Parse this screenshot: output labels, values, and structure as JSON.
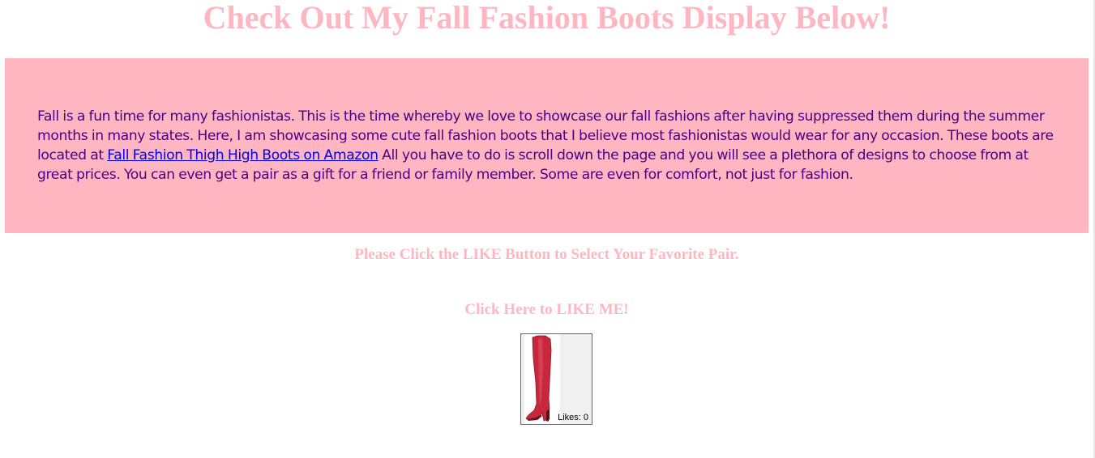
{
  "page": {
    "title": "Check Out My Fall Fashion Boots Display Below!"
  },
  "intro": {
    "text_before_link": "Fall is a fun time for many fashionistas. This is the time whereby we love to showcase our fall fashions after having suppressed them during the summer months in many states. Here, I am showcasing some cute fall fashion boots that I believe most fashionistas would wear for any occasion. These boots are located at ",
    "link_text": "Fall Fashion Thigh High Boots on Amazon",
    "text_after_link": " All you have to do is scroll down the page and you will see a plethora of designs to choose from at great prices. You can even get a pair as a gift for a friend or family member. Some are even for comfort, not just for fashion."
  },
  "instructions": {
    "text": "Please Click the LIKE Button to Select Your Favorite Pair."
  },
  "like_section": {
    "cta_text": "Click Here to LIKE ME!",
    "likes_label": "Likes: 0",
    "image_icon": "red-thigh-high-boot-image"
  },
  "colors": {
    "heading_pink": "#ffb6c1",
    "panel_pink": "#ffb6c1",
    "body_text": "#4b0082",
    "link": "#0000ee",
    "boot_red": "#c8283c"
  }
}
